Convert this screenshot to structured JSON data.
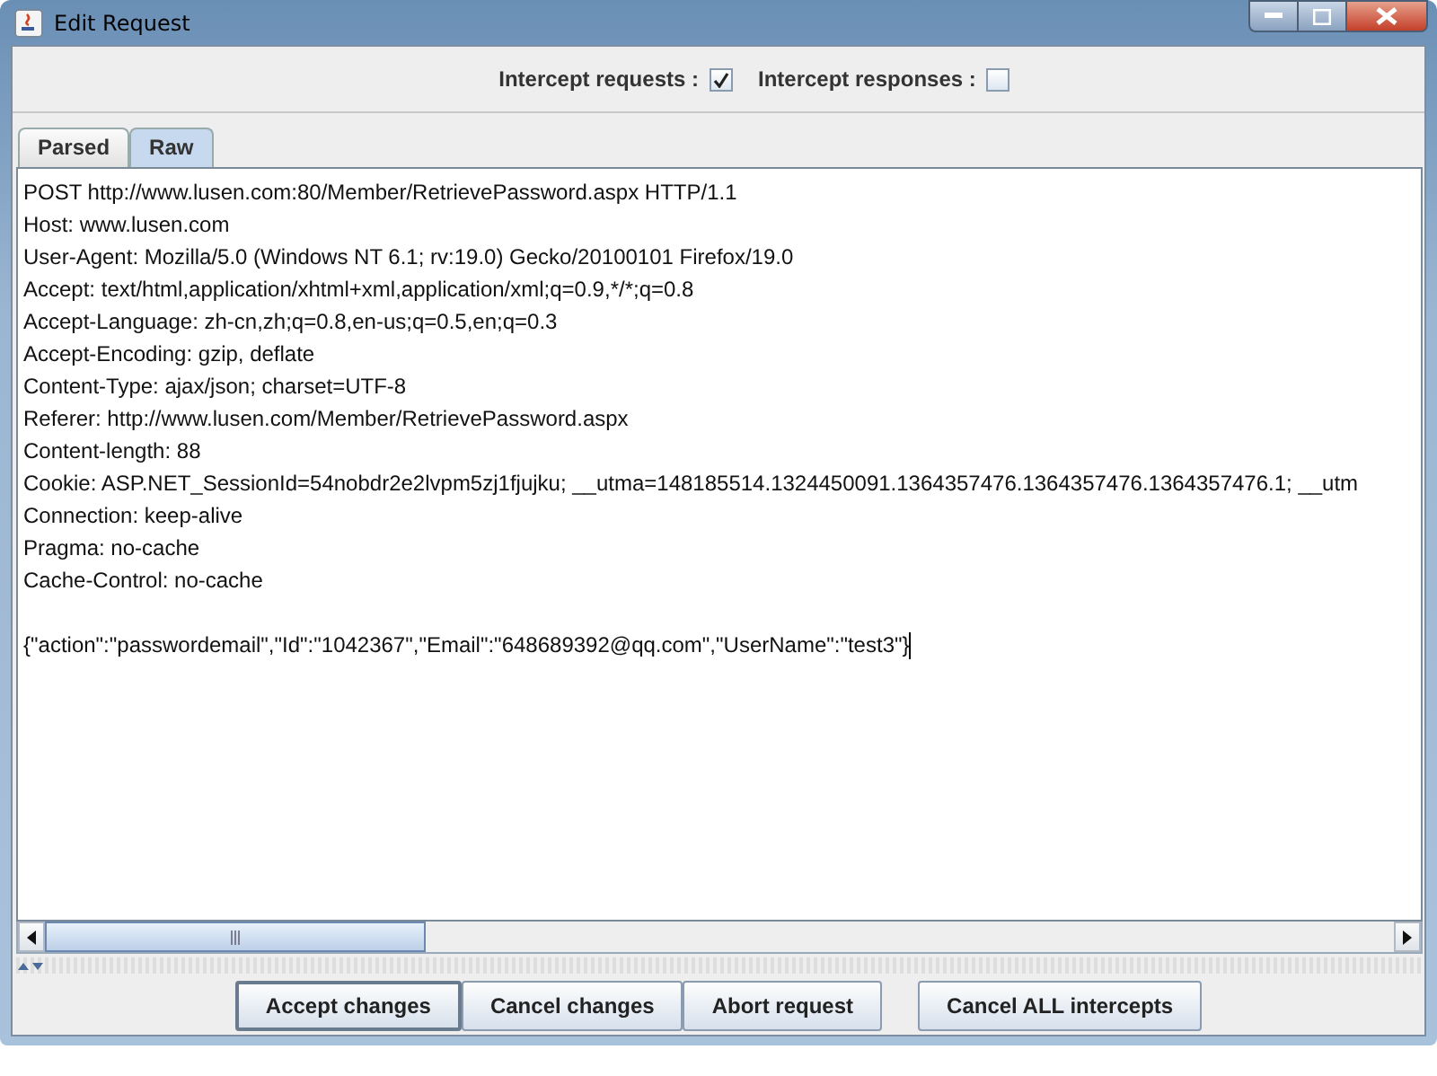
{
  "window": {
    "title": "Edit Request"
  },
  "intercept_options": [
    {
      "label": "Intercept requests :",
      "checked": true
    },
    {
      "label": "Intercept responses :",
      "checked": false
    }
  ],
  "tabs": [
    {
      "label": "Parsed",
      "selected": false
    },
    {
      "label": "Raw",
      "selected": true
    }
  ],
  "request_lines": [
    "POST http://www.lusen.com:80/Member/RetrievePassword.aspx HTTP/1.1",
    "Host: www.lusen.com",
    "User-Agent: Mozilla/5.0 (Windows NT 6.1; rv:19.0) Gecko/20100101 Firefox/19.0",
    "Accept: text/html,application/xhtml+xml,application/xml;q=0.9,*/*;q=0.8",
    "Accept-Language: zh-cn,zh;q=0.8,en-us;q=0.5,en;q=0.3",
    "Accept-Encoding: gzip, deflate",
    "Content-Type: ajax/json; charset=UTF-8",
    "Referer: http://www.lusen.com/Member/RetrievePassword.aspx",
    "Content-length: 88",
    "Cookie: ASP.NET_SessionId=54nobdr2e2lvpm5zj1fjujku; __utma=148185514.1324450091.1364357476.1364357476.1364357476.1; __utm",
    "Connection: keep-alive",
    "Pragma: no-cache",
    "Cache-Control: no-cache"
  ],
  "request_body": "{\"action\":\"passwordemail\",\"Id\":\"1042367\",\"Email\":\"648689392@qq.com\",\"UserName\":\"test3\"}",
  "buttons": [
    {
      "label": "Accept changes",
      "focused": true
    },
    {
      "label": "Cancel changes",
      "focused": false
    },
    {
      "label": "Abort request",
      "focused": false
    },
    {
      "label": "Cancel ALL intercepts",
      "focused": false
    }
  ]
}
